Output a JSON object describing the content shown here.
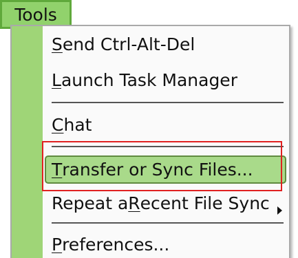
{
  "menubar": {
    "tools_label": "Tools"
  },
  "menu": {
    "items": [
      {
        "id": "send-ctrl-alt-del",
        "mnemonic": "S",
        "rest": "end Ctrl-Alt-Del"
      },
      {
        "id": "launch-task-manager",
        "mnemonic": "L",
        "rest": "aunch Task Manager"
      },
      {
        "id": "chat",
        "mnemonic": "C",
        "rest": "hat"
      },
      {
        "id": "transfer-or-sync-files",
        "mnemonic": "T",
        "rest": "ransfer or Sync Files..."
      },
      {
        "id": "repeat-recent-file-sync",
        "prefix": "Repeat a ",
        "mnemonic": "R",
        "rest": "ecent File Sync"
      },
      {
        "id": "preferences",
        "mnemonic": "P",
        "rest": "references..."
      }
    ]
  },
  "colors": {
    "accent": "#91d26c",
    "gutter": "#9fd577",
    "highlight": "#a9da8a",
    "annotation": "#e02020"
  }
}
